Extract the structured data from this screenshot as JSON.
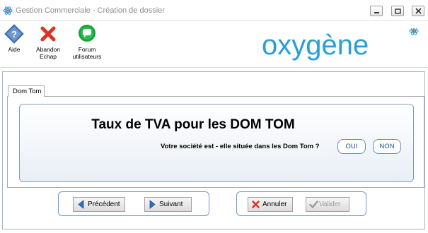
{
  "window": {
    "title": "Gestion Commerciale - Création de dossier"
  },
  "toolbar": {
    "help_label": "Aide",
    "abandon_label_1": "Abandon",
    "abandon_label_2": "Echap",
    "forum_label_1": "Forum",
    "forum_label_2": "utilisateurs"
  },
  "logo": {
    "text": "oxygène",
    "color": "#2a9fd6"
  },
  "tab": {
    "label": "Dom Tom"
  },
  "content": {
    "heading": "Taux de TVA pour les DOM TOM",
    "question": "Votre société est - elle située dans les Dom Tom ?",
    "yes_label": "OUI",
    "no_label": "NON"
  },
  "navigation": {
    "previous_label": "Précédent",
    "next_label": "Suivant"
  },
  "actions": {
    "cancel_label": "Annuler",
    "validate_label": "Valider"
  },
  "icons": {
    "app": "atom-icon",
    "help": "help-diamond-icon",
    "abandon": "red-x-icon",
    "forum": "chat-bubble-icon",
    "previous": "arrow-left-icon",
    "next": "arrow-right-icon",
    "cancel": "red-x-icon",
    "validate": "checkmark-icon"
  }
}
